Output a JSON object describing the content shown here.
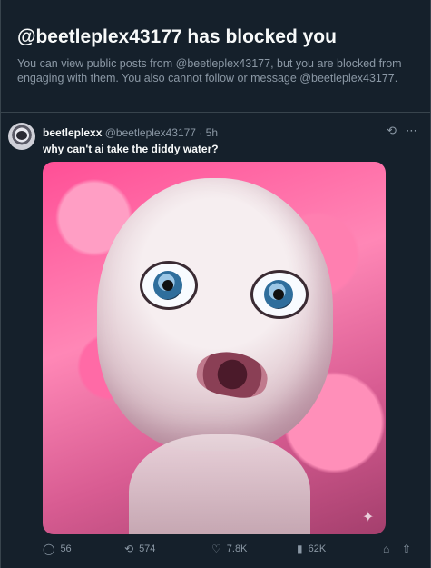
{
  "blocked": {
    "title": "@beetleplex43177 has blocked you",
    "description": "You can view public posts from @beetleplex43177, but you are blocked from engaging with them. You also cannot follow or message @beetleplex43177."
  },
  "tweet": {
    "display_name": "beetleplexx",
    "handle": "@beetleplex43177",
    "dot": "·",
    "time": "5h",
    "text": "why can't ai take the diddy water?",
    "stats": {
      "replies": "56",
      "reposts": "574",
      "likes": "7.8K",
      "views": "62K"
    }
  },
  "icons": {
    "grok": "grok-icon",
    "more": "more-icon",
    "reply": "reply-icon",
    "repost": "repost-icon",
    "like": "heart-icon",
    "views": "views-icon",
    "bookmark": "bookmark-icon",
    "share": "share-icon",
    "sparkle": "sparkle-icon"
  },
  "colors": {
    "background": "#15202b",
    "border": "#38444d",
    "text": "#f7f9f9",
    "muted": "#8b98a5"
  }
}
